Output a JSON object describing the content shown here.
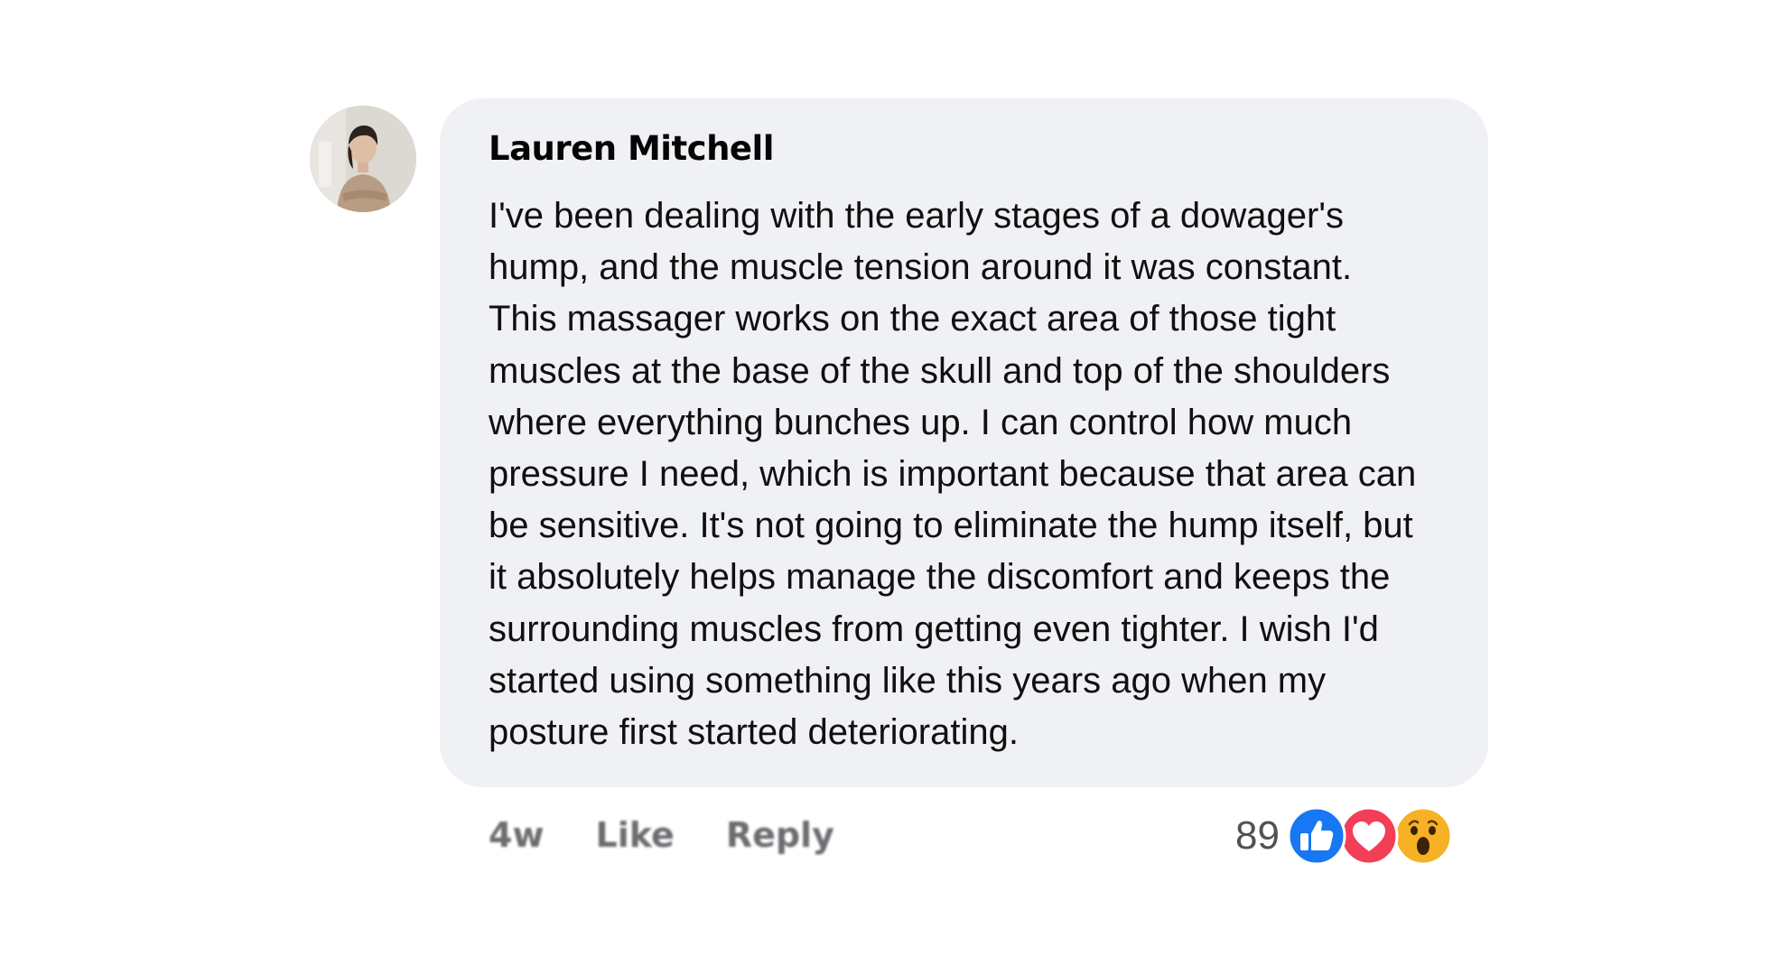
{
  "comment": {
    "author": "Lauren Mitchell",
    "text": "I've been dealing with the early stages of a dowager's\nhump, and the muscle tension around it was constant.\nThis massager works on the exact area of those tight\nmuscles at the base of the skull and top of the shoulders\nwhere everything bunches up. I can control how much\npressure I need, which is important because that area can\nbe sensitive. It's not going to eliminate the hump itself, but\nit absolutely helps manage the discomfort and keeps the\nsurrounding muscles from getting even tighter. I wish I'd\nstarted using something like this years ago when my\nposture first started deteriorating.",
    "time": "4w",
    "like_label": "Like",
    "reply_label": "Reply",
    "reaction_count": "89",
    "reaction_icons": [
      "like-icon",
      "love-icon",
      "wow-icon"
    ]
  },
  "colors": {
    "bubble_bg": "#f0f1f4",
    "like_blue": "#1877f2",
    "love_red": "#f33e58",
    "wow_yellow": "#f7b125",
    "action_gray": "#6b6d70"
  }
}
